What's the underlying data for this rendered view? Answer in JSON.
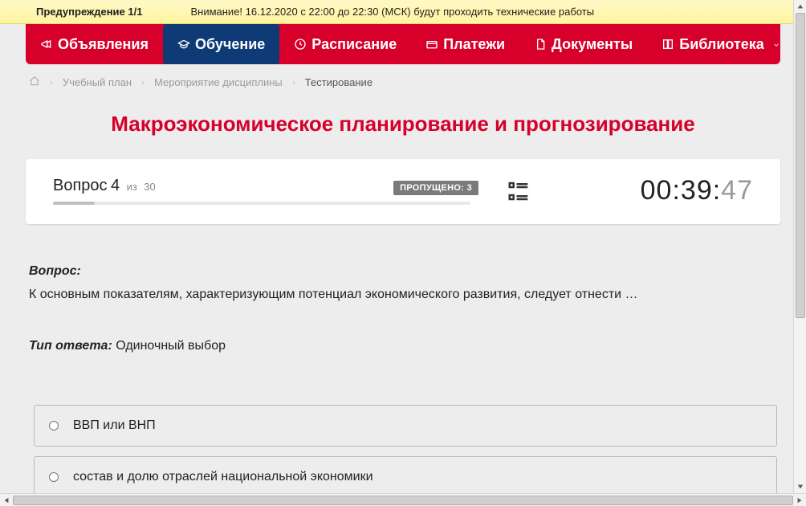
{
  "warning": {
    "title": "Предупреждение 1/1",
    "message": "Внимание! 16.12.2020 с 22:00 до 22:30 (МСК) будут проходить технические работы",
    "close": "x"
  },
  "nav": {
    "items": [
      {
        "label": "Объявления"
      },
      {
        "label": "Обучение"
      },
      {
        "label": "Расписание"
      },
      {
        "label": "Платежи"
      },
      {
        "label": "Документы"
      },
      {
        "label": "Библиотека"
      }
    ]
  },
  "breadcrumbs": {
    "plan": "Учебный план",
    "event": "Мероприятие дисциплины",
    "current": "Тестирование"
  },
  "page": {
    "title": "Макроэкономическое планирование и прогнозирование"
  },
  "quiz": {
    "question_word": "Вопрос",
    "question_num": "4",
    "of_word": "из",
    "total": "30",
    "skipped_label": "ПРОПУЩЕНО: 3",
    "timer_main": "00:39:",
    "timer_sec": "47",
    "q_label": "Вопрос:",
    "q_text": "К основным показателям, характеризующим потенциал экономического развития, следует отнести …",
    "answer_type_label": "Тип ответа:",
    "answer_type_value": " Одиночный выбор"
  },
  "answers": [
    {
      "text": "ВВП или ВНП"
    },
    {
      "text": "состав и долю отраслей национальной экономики"
    }
  ]
}
